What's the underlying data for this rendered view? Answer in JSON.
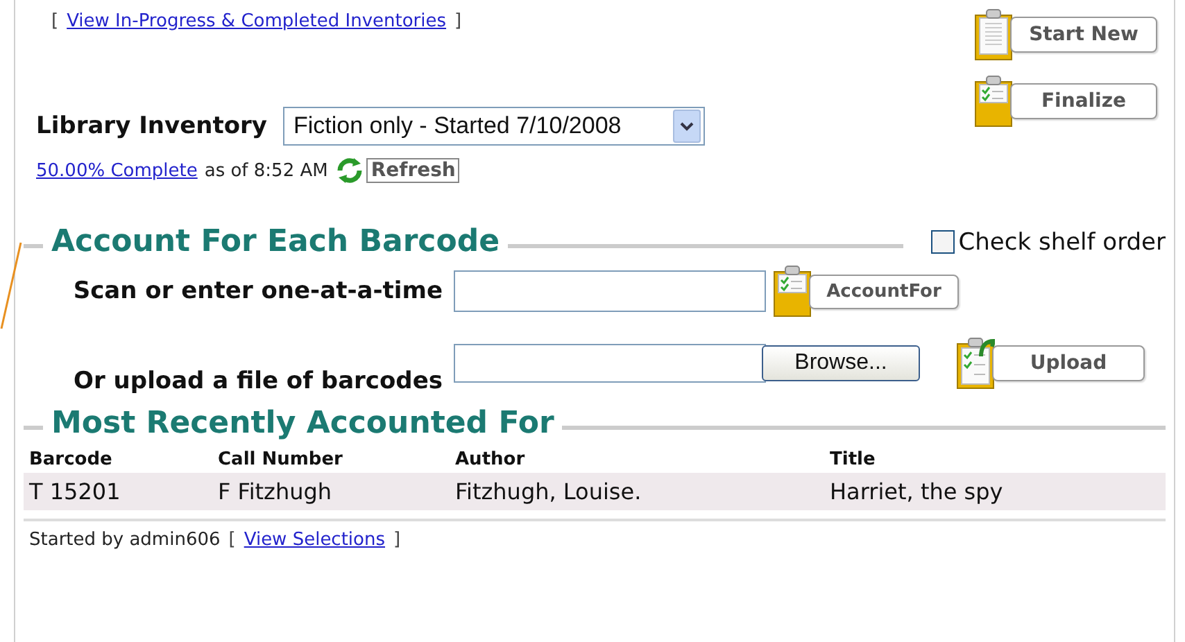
{
  "inventories_link": {
    "open": "[",
    "label": "View In-Progress & Completed Inventories",
    "close": "]"
  },
  "actions": [
    {
      "kind": "blank",
      "label": "Start New"
    },
    {
      "kind": "checked",
      "label": "Finalize"
    }
  ],
  "inventory": {
    "label": "Library Inventory",
    "value": "Fiction only - Started 7/10/2008"
  },
  "progress": {
    "link": "50.00% Complete",
    "text": "as of 8:52 AM",
    "refresh": "Refresh"
  },
  "account_section": {
    "title": "Account For Each Barcode",
    "shelf_order": {
      "label": "Check shelf order",
      "checked": false
    },
    "scan": {
      "label": "Scan or enter one-at-a-time",
      "button": "AccountFor"
    },
    "upload": {
      "label": "Or upload a file of barcodes",
      "browse": "Browse...",
      "button": "Upload"
    }
  },
  "recent_section": {
    "title": "Most Recently Accounted For",
    "columns": [
      "Barcode",
      "Call Number",
      "Author",
      "Title"
    ],
    "rows": [
      [
        "T 15201",
        "F Fitzhugh",
        "Fitzhugh, Louise.",
        "Harriet, the spy"
      ]
    ]
  },
  "footer": {
    "text": "Started by admin606",
    "open": "[",
    "link": "View Selections",
    "close": "]"
  }
}
